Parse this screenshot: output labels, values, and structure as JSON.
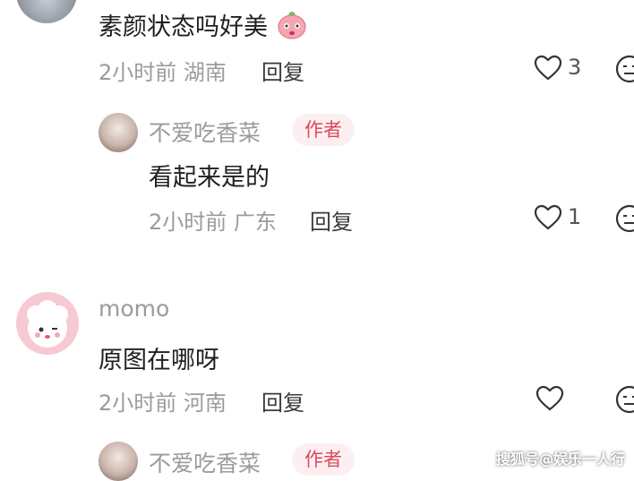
{
  "comments": [
    {
      "text": "素颜状态吗好美",
      "time": "2小时前",
      "location": "湖南",
      "reply_label": "回复",
      "like_count": "3"
    },
    {
      "author": "不爱吃香菜",
      "badge": "作者",
      "text": "看起来是的",
      "time": "2小时前",
      "location": "广东",
      "reply_label": "回复",
      "like_count": "1"
    },
    {
      "author": "momo",
      "text": "原图在哪呀",
      "time": "2小时前",
      "location": "河南",
      "reply_label": "回复"
    },
    {
      "author": "不爱吃香菜",
      "badge": "作者"
    }
  ],
  "watermark": "搜狐号@娱乐一人行",
  "colors": {
    "badge_bg": "#fdeff1",
    "badge_text": "#d94a5e",
    "meta": "#9b9b9b"
  },
  "icons": [
    "heart-icon",
    "emoji-icon",
    "peach-emoji"
  ]
}
